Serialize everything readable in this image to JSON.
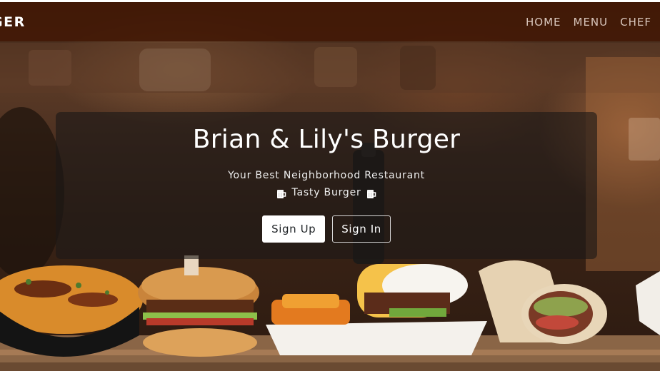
{
  "navbar": {
    "brand": "GER",
    "links": [
      "HOME",
      "MENU",
      "CHEF"
    ]
  },
  "hero": {
    "title": "Brian & Lily's Burger",
    "subtitle": "Your Best Neighborhood Restaurant",
    "tagline": "Tasty Burger",
    "tagline_icon": "beer-mug-icon",
    "buttons": {
      "sign_up": "Sign Up",
      "sign_in": "Sign In"
    }
  },
  "colors": {
    "navbar_bg": "#421806",
    "nav_link": "#d9c6bc",
    "card_bg": "#1c1816",
    "primary_button_bg": "#ffffff"
  }
}
